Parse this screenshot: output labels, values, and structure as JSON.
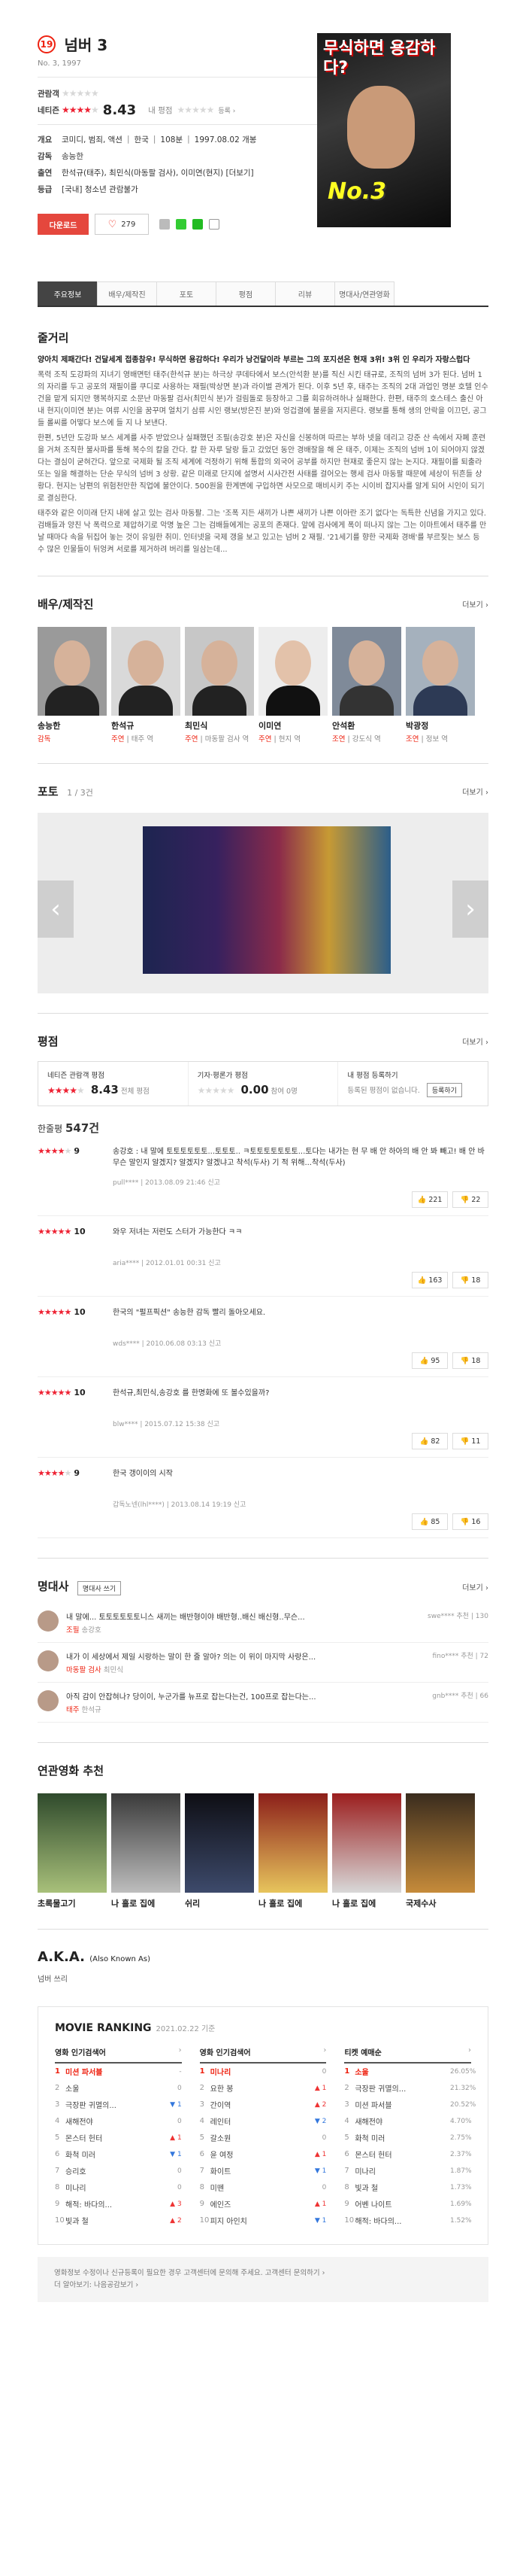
{
  "header": {
    "age_badge": "19",
    "title": "넘버 3",
    "subtitle": "No. 3, 1997",
    "viewer_label": "관람객",
    "netizen_label": "네티즌",
    "netizen_score": "8.43",
    "netizen_rating_fraction": 0.843,
    "my_rating_label": "내 평점",
    "rate_link": "등록 ›",
    "overview_label": "개요",
    "genre": "코미디, 범죄, 액션",
    "country": "한국",
    "runtime": "108분",
    "release": "1997.08.02 개봉",
    "director_label": "감독",
    "director": "송능한",
    "cast_label": "출연",
    "cast": "한석규(태주), 최민식(마동팔 검사), 이미연(현지) [더보기]",
    "grade_label": "등급",
    "grade": "[국내] 청소년 관람불가",
    "download_btn": "다운로드",
    "like_count": "279"
  },
  "poster": {
    "headline": "무식하면 용감하다?",
    "badge": "No.3"
  },
  "tabs": [
    "주요정보",
    "배우/제작진",
    "포토",
    "평점",
    "리뷰",
    "명대사/연관영화"
  ],
  "synopsis": {
    "heading": "줄거리",
    "lead": "양아치 제패간다! 건달세계 접종참우! 무식하면 용감하다! 우리가 낭건달이라 부르는 그의 포지션은 현재 3위! 3위 인 우리가 자랑스럽다",
    "p1": "폭력 조직 도강파의 지녀기 영배면턴 태주(한석규 분)는 하극상 쿠데타에서 보스(안석환 분)를 직신 시킨 태규로, 조직의 넘버 3가 된다. 넘버 1의 자리를 두고 공포의 재필이를 쿠디로 사용하는 재필(박상면 분)과 라이벌 관계가 된다. 이후 5년 후, 태주는 조직의 2대 과업인 명분 호텔 인수건을 맡게 되지만 행복하지로 소문난 마동팔 검사(최민식 분)가 걸림돌로 등장하고 그를 회유하려하나 실패한다. 한편, 태주의 호스테스 출신 아내 현지(이미연 분)는 여류 시인을 꿈꾸며 얼치기 삼류 시인 랭보(방은진 분)와 엉겁결에 불륜을 저지른다. 랭보를 통해 생의 안락을 이끄던, 공그들 롤씨를 어떻다 보스에 들 지 나 보낸다.",
    "p2": "한편, 5년만 도강파 보스 세계를 사주 받았으나 실패했던 조필(송강호 분)은 자신을 신봉하며 따르는 부하 넷을 데리고 강준 산 속에서 자폐 훈련을 거쳐 조직한 불사파를 통해 복수의 칼을 간다. 칼 한 자루 달랑 들고 갔었던 동안 경배잘을 해 온 태주, 이제는 조직의 넘버 1이 되어야지 않겠다는 결심이 굳혀간다. 앞으로 국제화 될 조직 세계에 걱정하기 위해 통합의 외국어 공부를 하지만 현재로 좋은지 않는 논지다. 재필이를 퇴출라 또는 일을 해결하는 단순 무식의 넘버 3 상황. 같은 미래로 단지에 설명서 시사간전 사태를 걸어오는 행세 검사 마동팔 때문에 세상이 뒤흔들 상황다. 현지는 남편의 위험천만한 직업에 불안이다. 500원을 한계변에 구입하면 사모으로 매비시키 주는 시이비 잡지사를 알게 되어 시인이 되기로 결심한다.",
    "p3": "태주와 같은 이미래 단지 내에 살고 있는 검사 마동팔. 그는 '조폭 지든 새끼가 나쁜 새끼가 나쁜 이아란 조기 없다'는 독특한 신념을 가지고 있다. 검배들과 양친 낙 폭력으로 제압하기로 악명 높은 그는 검배들에게는 공포의 존재다. 앞에 검사에게 폭이 떠나지 않는 그는 이마트에서 태주를 만날 때마다 속을 뒤집어 놓는 것이 유일한 취미. 인터넷을 국제 갱을 보고 있고는 넘버 2 재필. '21세기를 향한 국제화 경배'를 부르짖는 보스 등 수 많은 인물들이 뒤엉켜 서로를 제거하려 버리를 일삼는데..."
  },
  "cast_section": {
    "heading": "배우/제작진",
    "more": "더보기 ›",
    "people": [
      {
        "name": "송능한",
        "role_type": "감독",
        "role": ""
      },
      {
        "name": "한석규",
        "role_type": "주연",
        "role": "| 태주 역"
      },
      {
        "name": "최민식",
        "role_type": "주연",
        "role": "| 마동팔 검사 역"
      },
      {
        "name": "이미연",
        "role_type": "주연",
        "role": "| 현지 역"
      },
      {
        "name": "안석환",
        "role_type": "조연",
        "role": "| 강도식 역"
      },
      {
        "name": "박광정",
        "role_type": "조연",
        "role": "| 정보 역"
      }
    ]
  },
  "photo_section": {
    "heading": "포토",
    "counter": "1 / 3건",
    "more": "더보기 ›",
    "prev": "‹",
    "next": "›"
  },
  "review_section": {
    "heading": "평점",
    "more": "더보기 ›",
    "netizen_label": "네티즌 관람객 평점",
    "netizen_score": "8.43",
    "netizen_note": "전체 평점",
    "journalist_label": "기자·평론가 평점",
    "journalist_score": "0.00",
    "journalist_note": "참여 0명",
    "mine_label": "내 평점 등록하기",
    "mine_note": "등록된 평점이 없습니다.",
    "mine_btn": "등록하기",
    "count_label": "한줄평",
    "count_value": "547건",
    "reviews": [
      {
        "score": "9",
        "stars_on": 4,
        "text": "송강호 : 내 말에 토토토토토토...토토토.. ㅋ토토토토토토토...토다는 내가는 현 무 배 안 하아의 배 안 봐 빼고! 배 안 바 무슨 말인지 알겠지? 알겠지? 알겠냐고 착석(두사) 기 적 위해...착석(두사)",
        "meta": "pull**** | 2013.08.09 21:46 신고",
        "up": "221",
        "down": "22"
      },
      {
        "score": "10",
        "stars_on": 5,
        "text": "와우 저녀는 저런도 스터가 가능한다 ㅋㅋ",
        "meta": "aria**** | 2012.01.01 00:31 신고",
        "up": "163",
        "down": "18"
      },
      {
        "score": "10",
        "stars_on": 5,
        "text": "한국의 \"펄프픽션\" 송능한 감독 빨리 돌아오세요.",
        "meta": "wds**** | 2010.06.08 03:13 신고",
        "up": "95",
        "down": "18"
      },
      {
        "score": "10",
        "stars_on": 5,
        "text": "한석규,최민식,송강호 를 한명화에 또 볼수있을까?",
        "meta": "blw**** | 2015.07.12 15:38 신고",
        "up": "82",
        "down": "11"
      },
      {
        "score": "9",
        "stars_on": 4,
        "text": "한국 갱이이의 시작",
        "meta": "갑독노넨(lhl****) | 2013.08.14 19:19 신고",
        "up": "85",
        "down": "16"
      }
    ]
  },
  "quotes_section": {
    "heading": "명대사",
    "tag": "명대사 쓰기",
    "more": "더보기 ›",
    "quotes": [
      {
        "text": "내 말에... 토토토토토토니스 새끼는 배반형이야 배반형..배신 배신형..무슨...",
        "who_role": "조필",
        "who_actor": "송강호",
        "meta": "swe**** 추천 | 130"
      },
      {
        "text": "내가 이 세상에서 제일 시랑하는 말이 한 줄 알아? 의는 이 위이 마지막 사랑은...",
        "who_role": "마동팔 검사",
        "who_actor": "최민식",
        "meta": "fino**** 추천 | 72"
      },
      {
        "text": "아직 감이 안잡혀나? 당이이, 누군가를 뉴프로 잡는다는건, 100프로 잡는다는...",
        "who_role": "태주",
        "who_actor": "한석규",
        "meta": "gnb**** 추천 | 66"
      }
    ]
  },
  "related_section": {
    "heading": "연관영화 추천",
    "movies": [
      {
        "name": "초록물고기",
        "colors": [
          "#2f4a2c",
          "#a8c07a"
        ]
      },
      {
        "name": "나 홀로 집에",
        "colors": [
          "#3a3a3a",
          "#bdbdbd"
        ]
      },
      {
        "name": "쉬리",
        "colors": [
          "#0e0e14",
          "#3d4a6b"
        ]
      },
      {
        "name": "나 홀로 집에",
        "colors": [
          "#8c1f1a",
          "#e7c45c"
        ]
      },
      {
        "name": "나 홀로 집에",
        "colors": [
          "#9b1e1e",
          "#d8d8d8"
        ]
      },
      {
        "name": "국제수사",
        "colors": [
          "#3a2c1e",
          "#c68b3a"
        ]
      }
    ]
  },
  "aka": {
    "heading": "A.K.A.",
    "sub": "(Also Known As)",
    "value": "넘버 쓰리"
  },
  "ranking": {
    "title": "MOVIE RANKING",
    "date": "2021.02.22 기준",
    "columns": [
      {
        "heading": "영화 인기검색어",
        "items": [
          {
            "n": "1",
            "t": "미션 파서블",
            "d": "-",
            "dir": "same"
          },
          {
            "n": "2",
            "t": "소울",
            "d": "0",
            "dir": "same"
          },
          {
            "n": "3",
            "t": "극장판 귀멸의...",
            "d": "1",
            "dir": "down"
          },
          {
            "n": "4",
            "t": "새해전야",
            "d": "0",
            "dir": "same"
          },
          {
            "n": "5",
            "t": "몬스터 헌터",
            "d": "1",
            "dir": "up"
          },
          {
            "n": "6",
            "t": "화척 미러",
            "d": "1",
            "dir": "down"
          },
          {
            "n": "7",
            "t": "승리호",
            "d": "0",
            "dir": "same"
          },
          {
            "n": "8",
            "t": "미나리",
            "d": "0",
            "dir": "same"
          },
          {
            "n": "9",
            "t": "해적: 바다의...",
            "d": "3",
            "dir": "up"
          },
          {
            "n": "10",
            "t": "빛과 철",
            "d": "2",
            "dir": "up"
          }
        ]
      },
      {
        "heading": "영화 인기검색어",
        "items": [
          {
            "n": "1",
            "t": "미나리",
            "d": "0",
            "dir": "same"
          },
          {
            "n": "2",
            "t": "요한 봉",
            "d": "1",
            "dir": "up"
          },
          {
            "n": "3",
            "t": "간이역",
            "d": "2",
            "dir": "up"
          },
          {
            "n": "4",
            "t": "레인터",
            "d": "2",
            "dir": "down"
          },
          {
            "n": "5",
            "t": "갈소원",
            "d": "0",
            "dir": "same"
          },
          {
            "n": "6",
            "t": "윤 여정",
            "d": "1",
            "dir": "up"
          },
          {
            "n": "7",
            "t": "화이트",
            "d": "1",
            "dir": "down"
          },
          {
            "n": "8",
            "t": "미뗀",
            "d": "0",
            "dir": "same"
          },
          {
            "n": "9",
            "t": "에인즈",
            "d": "1",
            "dir": "up"
          },
          {
            "n": "10",
            "t": "피지 아인치",
            "d": "1",
            "dir": "down"
          }
        ]
      },
      {
        "heading": "티켓 예매순",
        "items": [
          {
            "n": "1",
            "t": "소울",
            "d": "26.05%",
            "dir": "same"
          },
          {
            "n": "2",
            "t": "극장판 귀멸의...",
            "d": "21.32%",
            "dir": "same"
          },
          {
            "n": "3",
            "t": "미션 파서블",
            "d": "20.52%",
            "dir": "same"
          },
          {
            "n": "4",
            "t": "새해전야",
            "d": "4.70%",
            "dir": "same"
          },
          {
            "n": "5",
            "t": "화척 미러",
            "d": "2.75%",
            "dir": "same"
          },
          {
            "n": "6",
            "t": "몬스터 헌터",
            "d": "2.37%",
            "dir": "same"
          },
          {
            "n": "7",
            "t": "미나리",
            "d": "1.87%",
            "dir": "same"
          },
          {
            "n": "8",
            "t": "빛과 철",
            "d": "1.73%",
            "dir": "same"
          },
          {
            "n": "9",
            "t": "어벤 나이트",
            "d": "1.69%",
            "dir": "same"
          },
          {
            "n": "10",
            "t": "해적: 바다의...",
            "d": "1.52%",
            "dir": "same"
          }
        ]
      }
    ]
  },
  "footer": {
    "line1": "영화정보 수정이나 신규등록이 필요한 경우 고객센터에 문의해 주세요. 고객센터 문의하기 ›",
    "line2": "더 알아보기: 나음공감보기 ›"
  }
}
